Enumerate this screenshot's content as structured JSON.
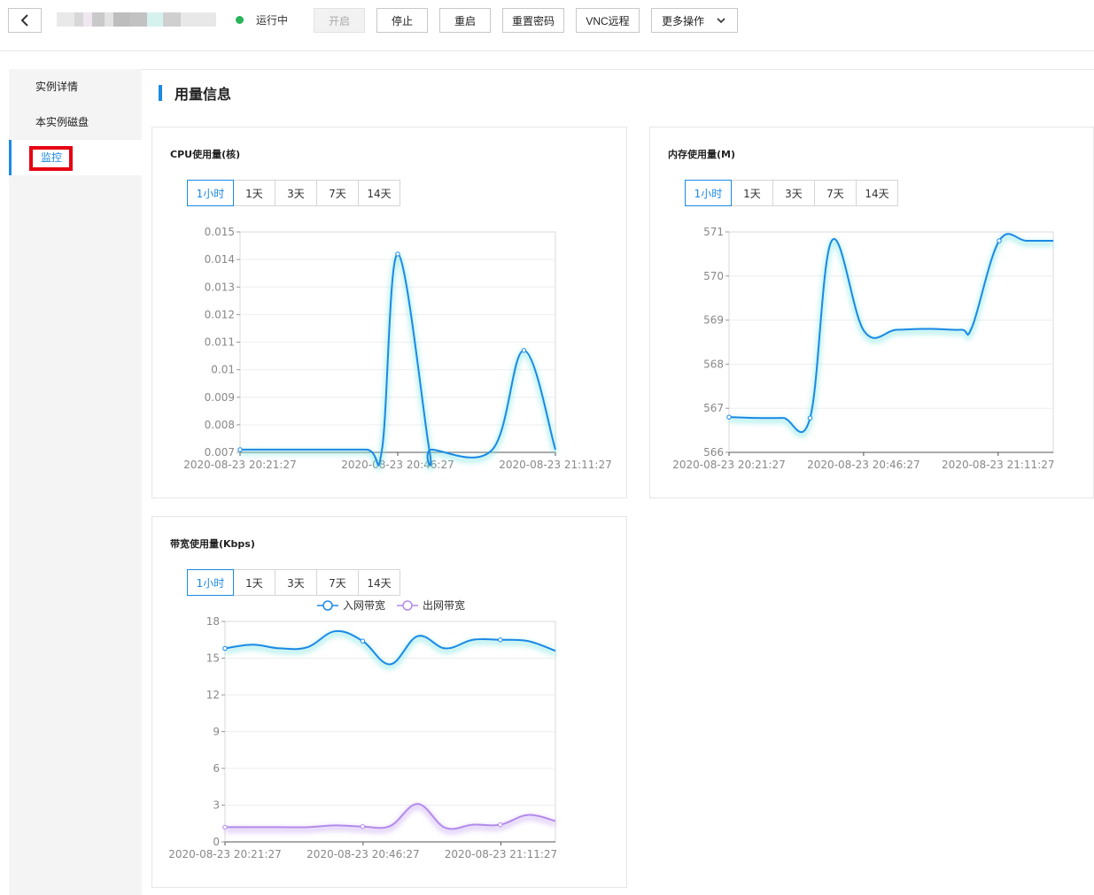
{
  "header": {
    "status_label": "运行中",
    "buttons": {
      "start": "开启",
      "stop": "停止",
      "restart": "重启",
      "reset_password": "重置密码",
      "vnc": "VNC远程",
      "more": "更多操作"
    },
    "colors": {
      "status": "#29b45a",
      "accent": "#1b89e5"
    }
  },
  "sidebar": {
    "items": [
      {
        "label": "实例详情"
      },
      {
        "label": "本实例磁盘"
      },
      {
        "label": "监控"
      }
    ]
  },
  "section": {
    "title": "用量信息"
  },
  "range_options": [
    "1小时",
    "1天",
    "3天",
    "7天",
    "14天"
  ],
  "chart_data": [
    {
      "id": "cpu",
      "type": "line",
      "title": "CPU使用量(核)",
      "ylim": [
        0.007,
        0.015
      ],
      "yticks": [
        "0.015",
        "0.014",
        "0.013",
        "0.012",
        "0.011",
        "0.01",
        "0.009",
        "0.008",
        "0.007"
      ],
      "xticks": [
        "2020-08-23 20:21:27",
        "2020-08-23 20:46:27",
        "2020-08-23 21:11:27"
      ],
      "x": [
        0,
        12,
        24,
        27,
        30,
        36,
        36.5,
        48,
        54,
        60
      ],
      "series": [
        {
          "values": [
            0.0071,
            0.0071,
            0.0071,
            0.0071,
            0.0142,
            0.0071,
            0.0071,
            0.0071,
            0.0107,
            0.0071
          ],
          "color": "#1b89e5"
        }
      ]
    },
    {
      "id": "mem",
      "type": "line",
      "title": "内存使用量(M)",
      "ylim": [
        566,
        571
      ],
      "yticks": [
        "571",
        "570",
        "569",
        "568",
        "567",
        "566"
      ],
      "xticks": [
        "2020-08-23 20:21:27",
        "2020-08-23 20:46:27",
        "2020-08-23 21:11:27"
      ],
      "x": [
        0,
        5,
        10,
        15,
        19,
        25,
        31,
        37,
        43,
        45,
        50,
        55,
        60
      ],
      "series": [
        {
          "values": [
            566.8,
            566.78,
            566.78,
            566.78,
            570.8,
            568.75,
            568.78,
            568.8,
            568.78,
            568.85,
            570.8,
            570.8,
            570.8
          ],
          "color": "#1b89e5"
        }
      ]
    },
    {
      "id": "bw",
      "type": "line",
      "title": "带宽使用量(Kbps)",
      "ylim": [
        0,
        18
      ],
      "yticks": [
        "18",
        "15",
        "12",
        "9",
        "6",
        "3",
        "0"
      ],
      "xticks": [
        "2020-08-23 20:21:27",
        "2020-08-23 20:46:27",
        "2020-08-23 21:11:27"
      ],
      "x": [
        0,
        5,
        10,
        15,
        20,
        25,
        30,
        35,
        40,
        45,
        50,
        55,
        60
      ],
      "series": [
        {
          "name": "入网带宽",
          "values": [
            15.8,
            16.1,
            15.8,
            15.9,
            17.2,
            16.4,
            14.5,
            16.8,
            15.8,
            16.5,
            16.5,
            16.4,
            15.6
          ],
          "color": "#1b89e5"
        },
        {
          "name": "出网带宽",
          "values": [
            1.2,
            1.2,
            1.2,
            1.2,
            1.35,
            1.25,
            1.3,
            3.1,
            1.15,
            1.4,
            1.4,
            2.2,
            1.7
          ],
          "color": "#b38bea"
        }
      ]
    }
  ]
}
